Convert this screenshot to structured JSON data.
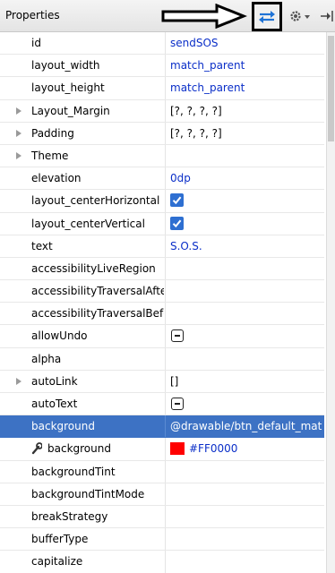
{
  "header": {
    "title": "Properties",
    "icons": {
      "sync": "sync-arrows-icon",
      "gear": "gear-icon",
      "pin": "pin-icon",
      "arrow": "black-arrow-annotation"
    }
  },
  "colors": {
    "selection": "#3d72c4",
    "value_blue": "#0a2ec8",
    "swatch": "#ff0000"
  },
  "rows": [
    {
      "name": "id",
      "value": "sendSOS",
      "kind": "text",
      "value_color": "blue"
    },
    {
      "name": "layout_width",
      "value": "match_parent",
      "kind": "text",
      "value_color": "blue"
    },
    {
      "name": "layout_height",
      "value": "match_parent",
      "kind": "text",
      "value_color": "blue"
    },
    {
      "name": "Layout_Margin",
      "value": "[?, ?, ?, ?]",
      "kind": "text",
      "value_color": "black",
      "expandable": true
    },
    {
      "name": "Padding",
      "value": "[?, ?, ?, ?]",
      "kind": "text",
      "value_color": "black",
      "expandable": true
    },
    {
      "name": "Theme",
      "value": "",
      "kind": "text",
      "value_color": "black",
      "expandable": true
    },
    {
      "name": "elevation",
      "value": "0dp",
      "kind": "text",
      "value_color": "blue"
    },
    {
      "name": "layout_centerHorizontal",
      "value": "",
      "kind": "checkbox",
      "checked": true
    },
    {
      "name": "layout_centerVertical",
      "value": "",
      "kind": "checkbox",
      "checked": true
    },
    {
      "name": "text",
      "value": "S.O.S.",
      "kind": "text",
      "value_color": "blue"
    },
    {
      "name": "accessibilityLiveRegion",
      "value": "",
      "kind": "text",
      "value_color": "black"
    },
    {
      "name": "accessibilityTraversalAfter",
      "value": "",
      "kind": "text",
      "value_color": "black"
    },
    {
      "name": "accessibilityTraversalBefore",
      "value": "",
      "kind": "text",
      "value_color": "black"
    },
    {
      "name": "allowUndo",
      "value": "",
      "kind": "tristate"
    },
    {
      "name": "alpha",
      "value": "",
      "kind": "text",
      "value_color": "black"
    },
    {
      "name": "autoLink",
      "value": "[]",
      "kind": "text",
      "value_color": "black",
      "expandable": true
    },
    {
      "name": "autoText",
      "value": "",
      "kind": "tristate"
    },
    {
      "name": "background",
      "value": "@drawable/btn_default_material",
      "kind": "text",
      "value_color": "black",
      "selected": true
    },
    {
      "name": "background",
      "value": "#FF0000",
      "kind": "swatch",
      "value_color": "blue",
      "wrench": true
    },
    {
      "name": "backgroundTint",
      "value": "",
      "kind": "text",
      "value_color": "black"
    },
    {
      "name": "backgroundTintMode",
      "value": "",
      "kind": "text",
      "value_color": "black"
    },
    {
      "name": "breakStrategy",
      "value": "",
      "kind": "text",
      "value_color": "black"
    },
    {
      "name": "bufferType",
      "value": "",
      "kind": "text",
      "value_color": "black"
    },
    {
      "name": "capitalize",
      "value": "",
      "kind": "text",
      "value_color": "black"
    }
  ]
}
